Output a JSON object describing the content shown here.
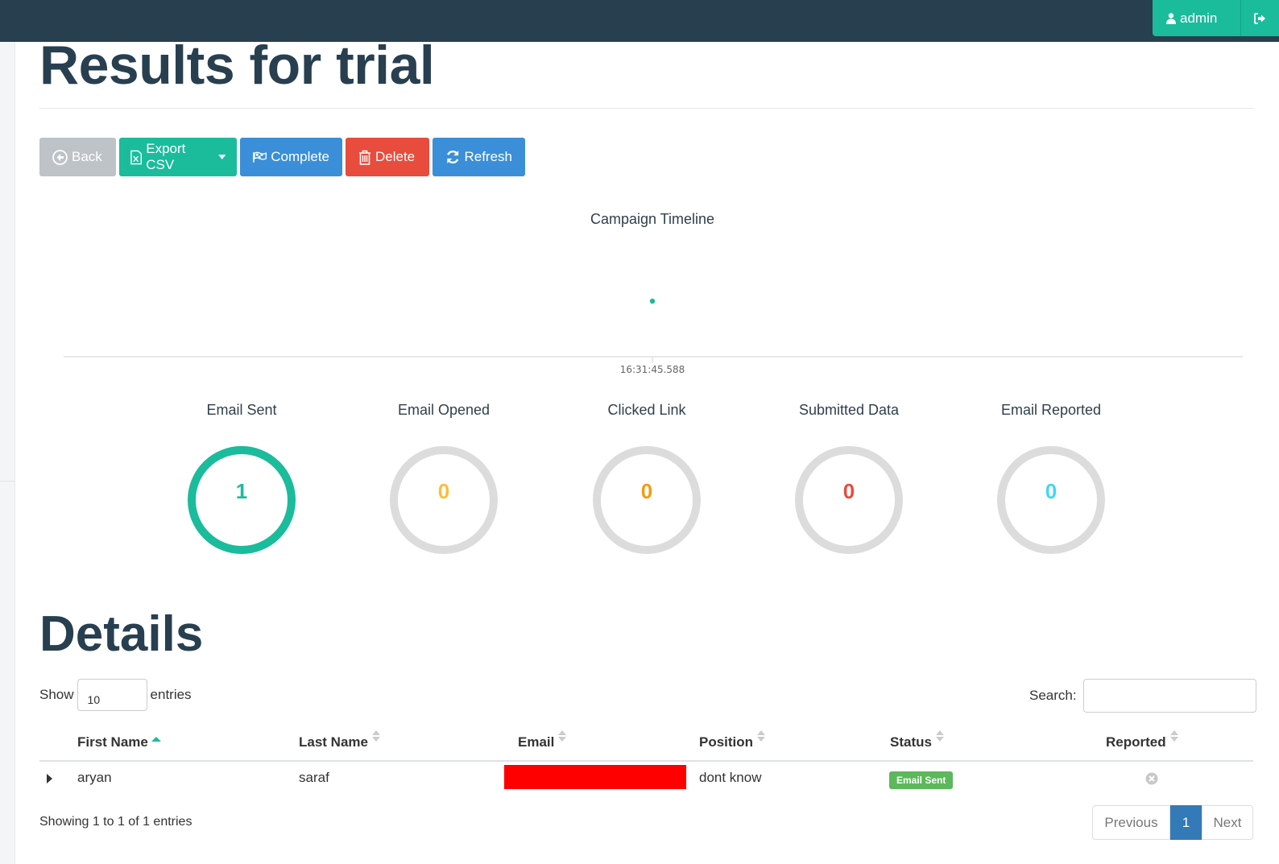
{
  "topbar": {
    "user_label": "admin"
  },
  "page": {
    "title": "Results for trial"
  },
  "toolbar": {
    "back_label": "Back",
    "export_label": "Export CSV",
    "complete_label": "Complete",
    "delete_label": "Delete",
    "refresh_label": "Refresh"
  },
  "timeline": {
    "title": "Campaign Timeline",
    "tick_label": "16:31:45.588",
    "accent": "#1abc9c"
  },
  "stats": [
    {
      "label": "Email Sent",
      "value": "1",
      "fraction": 1.0,
      "color": "#1abc9c"
    },
    {
      "label": "Email Opened",
      "value": "0",
      "fraction": 0.0,
      "color": "#f9bf3b"
    },
    {
      "label": "Clicked Link",
      "value": "0",
      "fraction": 0.0,
      "color": "#f39c12"
    },
    {
      "label": "Submitted Data",
      "value": "0",
      "fraction": 0.0,
      "color": "#e74c3c"
    },
    {
      "label": "Email Reported",
      "value": "0",
      "fraction": 0.0,
      "color": "#45d6ef"
    }
  ],
  "details": {
    "title": "Details",
    "show_label": "Show",
    "entries_label": "entries",
    "page_length": "10",
    "search_label": "Search:",
    "columns": [
      "First Name",
      "Last Name",
      "Email",
      "Position",
      "Status",
      "Reported"
    ],
    "rows": [
      {
        "first_name": "aryan",
        "last_name": "saraf",
        "position": "dont know",
        "status": "Email Sent"
      }
    ],
    "info": "Showing 1 to 1 of 1 entries",
    "pagination": {
      "previous": "Previous",
      "current": "1",
      "next": "Next"
    }
  },
  "colors": {
    "navbar": "#283f50",
    "primary": "#3a8fd8",
    "success": "#1abc9c",
    "danger": "#e74c3c",
    "muted": "#bdc3c7"
  }
}
